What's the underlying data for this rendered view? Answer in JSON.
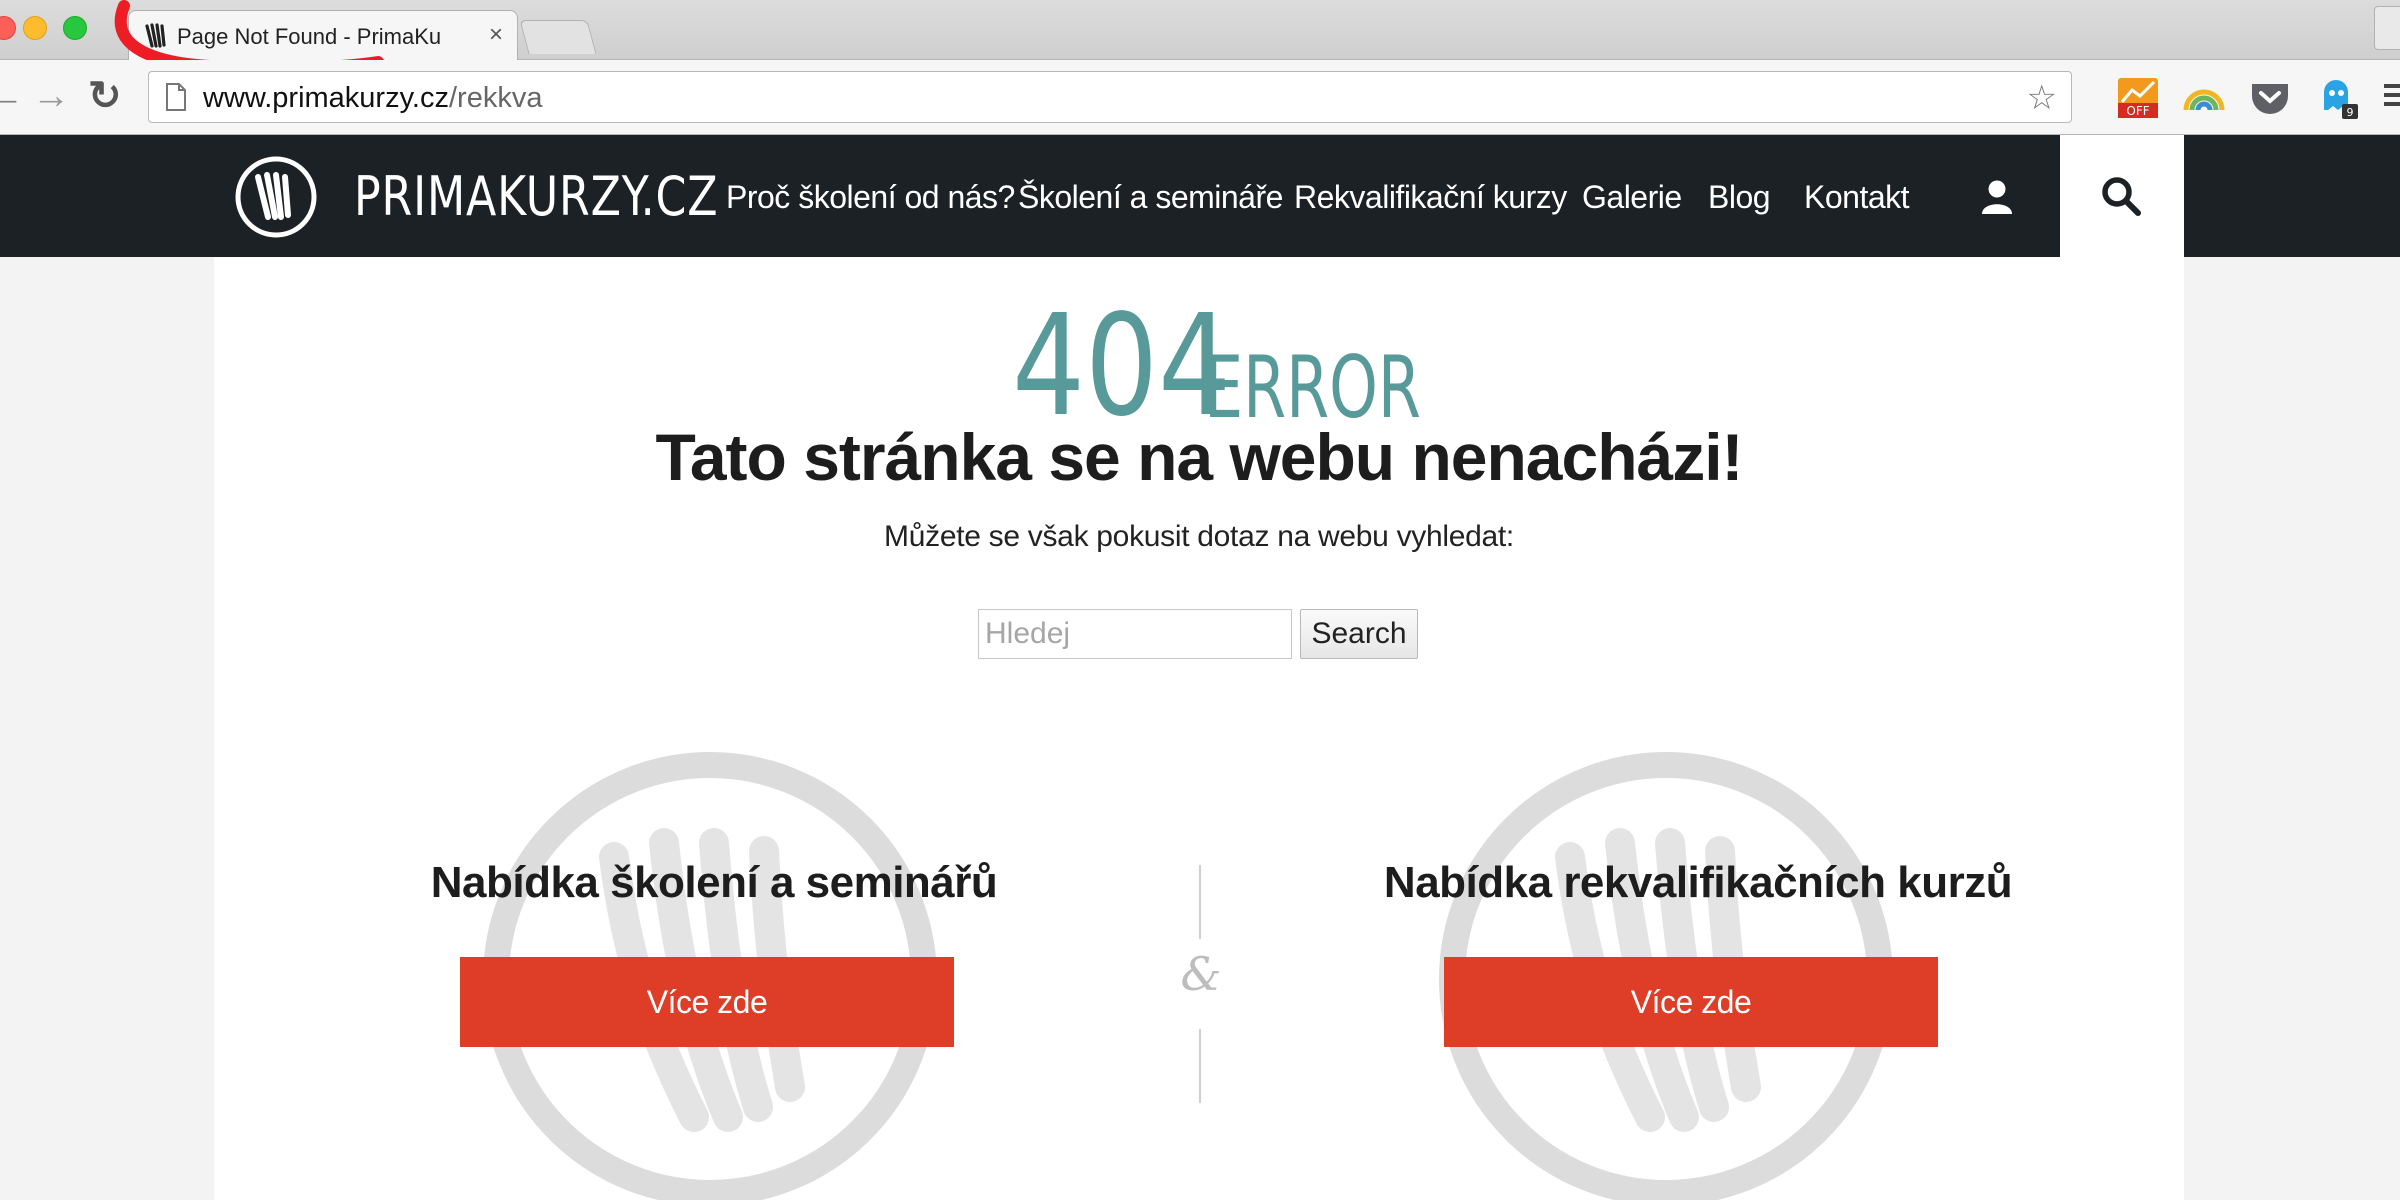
{
  "browser": {
    "tab_title": "Page Not Found - PrimaKu",
    "tab_close": "×",
    "url_domain": "www.primakurzy.cz",
    "url_path": "/rekkva",
    "nav": {
      "back": "←",
      "forward": "→",
      "reload": "↻"
    },
    "star": "☆",
    "extensions": {
      "off_badge": "OFF",
      "ghost_count": "9"
    }
  },
  "site": {
    "logo_text": "PRIMAKURZY.CZ",
    "nav_items": [
      "Proč školení od nás?",
      "Školení a semináře",
      "Rekvalifikační kurzy",
      "Galerie",
      "Blog",
      "Kontakt"
    ]
  },
  "error": {
    "code": "404",
    "word": "ERROR",
    "headline": "Tato stránka se na webu nenacházi!",
    "subline": "Můžete se však pokusit dotaz na webu vyhledat:"
  },
  "search": {
    "placeholder": "Hledej",
    "button_label": "Search"
  },
  "columns": {
    "left_title": "Nabídka školení a seminářů",
    "right_title": "Nabídka rekvalifikačních kurzů",
    "cta_label": "Více zde",
    "separator": "&"
  },
  "colors": {
    "header_bg": "#1c2126",
    "accent_teal": "#58999a",
    "cta_red": "#de3e28",
    "annotation_red": "#ee1c25"
  }
}
